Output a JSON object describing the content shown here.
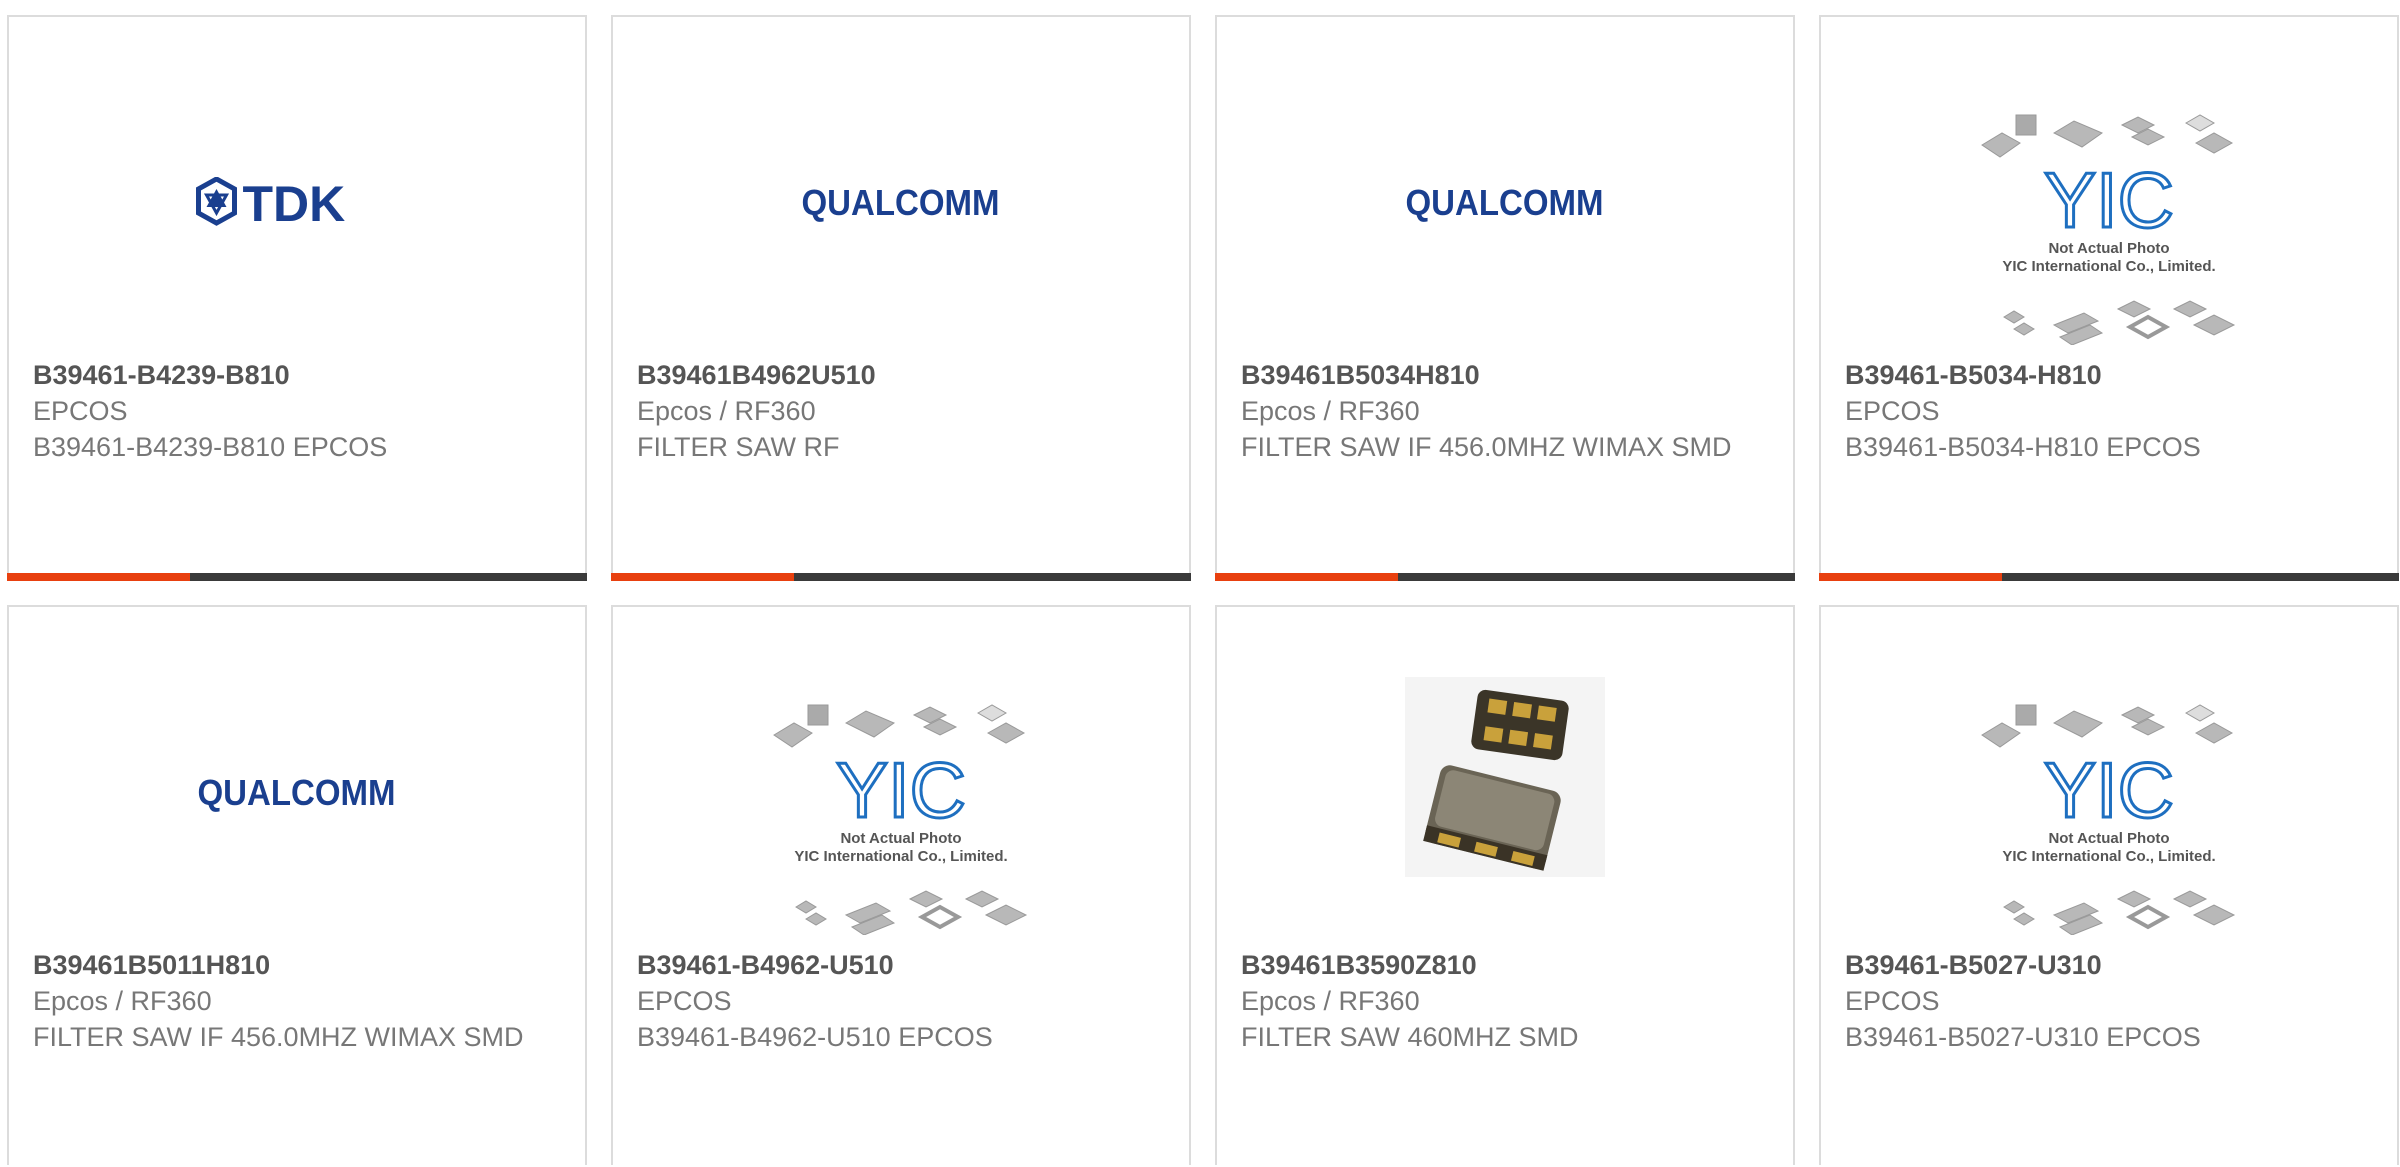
{
  "colors": {
    "accent": "#e8400f",
    "bar_dark": "#3a3a3a",
    "logo_blue": "#1a3f8f",
    "yic_blue": "#1e6fc0"
  },
  "logos": {
    "tdk": "TDK",
    "qualcomm": "QUALCOMM",
    "yic": "YIC",
    "yic_line1": "Not Actual Photo",
    "yic_line2": "YIC International Co., Limited."
  },
  "products": [
    {
      "image": "tdk-logo",
      "part_number": "B39461-B4239-B810",
      "manufacturer": "EPCOS",
      "description": "B39461-B4239-B810 EPCOS"
    },
    {
      "image": "qualcomm-logo",
      "part_number": "B39461B4962U510",
      "manufacturer": "Epcos / RF360",
      "description": "FILTER SAW RF"
    },
    {
      "image": "qualcomm-logo",
      "part_number": "B39461B5034H810",
      "manufacturer": "Epcos / RF360",
      "description": "FILTER SAW IF 456.0MHZ WIMAX SMD"
    },
    {
      "image": "yic-placeholder",
      "part_number": "B39461-B5034-H810",
      "manufacturer": "EPCOS",
      "description": "B39461-B5034-H810 EPCOS"
    },
    {
      "image": "qualcomm-logo",
      "part_number": "B39461B5011H810",
      "manufacturer": "Epcos / RF360",
      "description": "FILTER SAW IF 456.0MHZ WIMAX SMD"
    },
    {
      "image": "yic-placeholder",
      "part_number": "B39461-B4962-U510",
      "manufacturer": "EPCOS",
      "description": "B39461-B4962-U510 EPCOS"
    },
    {
      "image": "saw-filter-photo",
      "part_number": "B39461B3590Z810",
      "manufacturer": "Epcos / RF360",
      "description": "FILTER SAW 460MHZ SMD"
    },
    {
      "image": "yic-placeholder",
      "part_number": "B39461-B5027-U310",
      "manufacturer": "EPCOS",
      "description": "B39461-B5027-U310 EPCOS"
    }
  ]
}
